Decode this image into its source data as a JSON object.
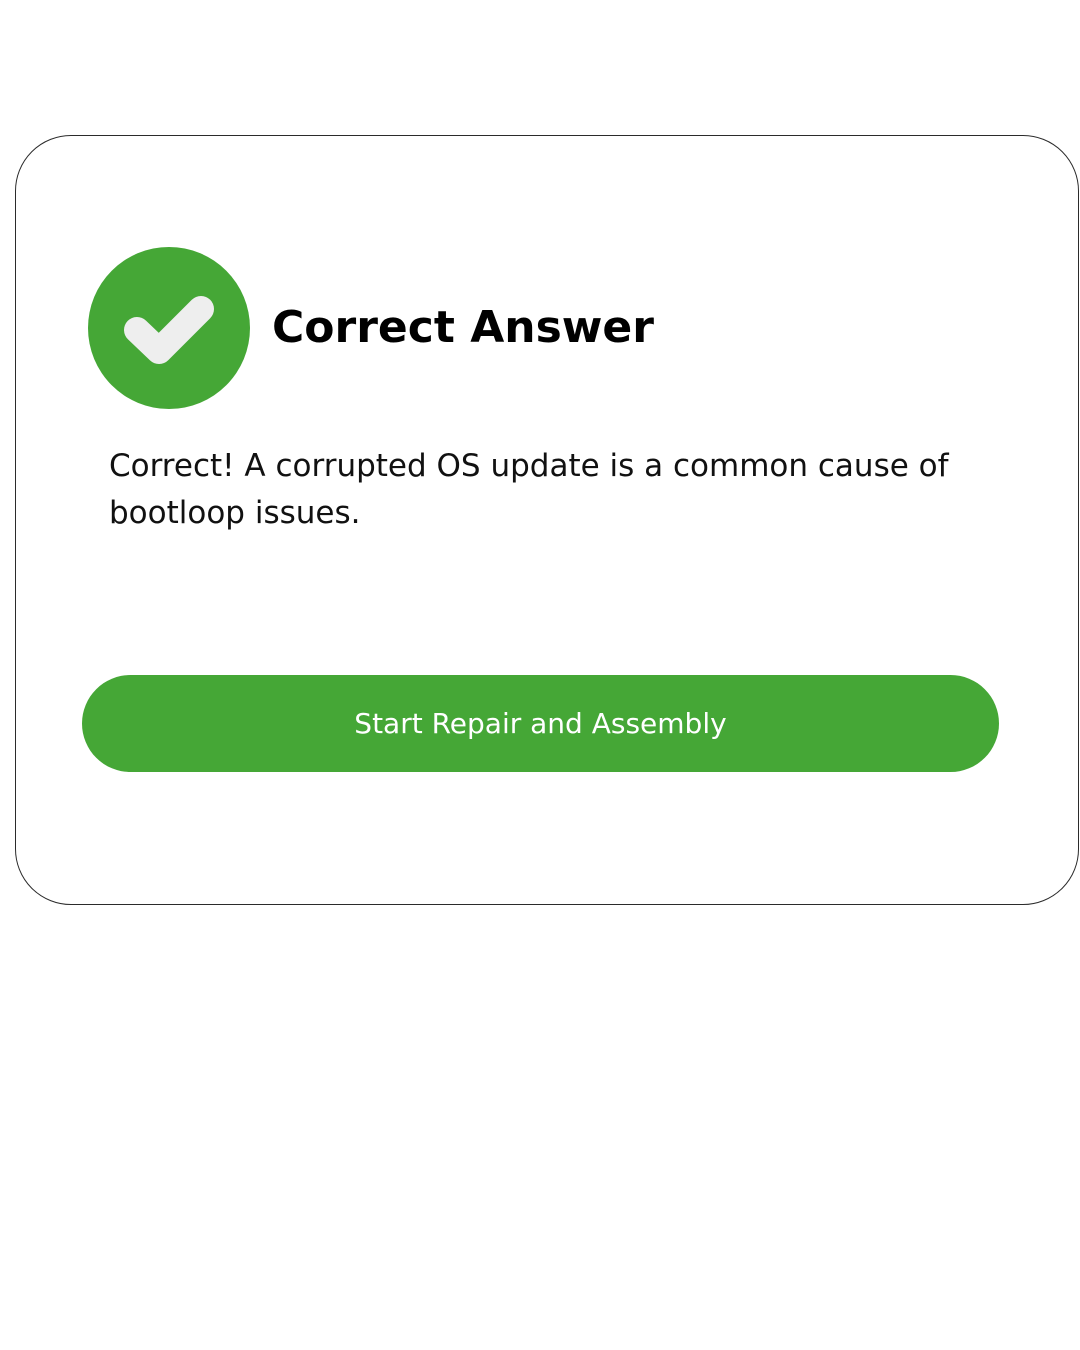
{
  "result": {
    "title": "Correct Answer",
    "icon": "check-circle-icon",
    "message": "Correct! A corrupted OS update is a common cause of bootloop issues."
  },
  "actions": {
    "primary_label": "Start Repair and Assembly"
  },
  "colors": {
    "accent": "#45a736",
    "check": "#eeeeee",
    "text": "#000000",
    "background": "#ffffff"
  }
}
